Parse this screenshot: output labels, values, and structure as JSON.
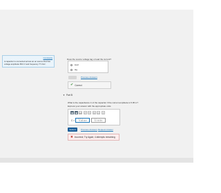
{
  "stray_text": "",
  "left_panel": {
    "constants_link": "Constants",
    "problem_text": "A capacitor is connected across an ac source that has voltage amplitude 58.0 V and frequency 77.0 Hz."
  },
  "part_a": {
    "question": "Does the source voltage lag or lead the current?",
    "options": [
      "lead",
      "lag"
    ],
    "previous_answers_link": "Previous Answers",
    "feedback": "Correct"
  },
  "part_b": {
    "toggle_icon": "triangle-down-icon",
    "label": "Part B",
    "question": "What is the capacitance C of the capacitor if the current amplitude is 5.05 A ?",
    "instruction": "Express your answer with the appropriate units.",
    "toolbar": [
      "▦",
      "▣",
      "μA",
      "↶",
      "↷",
      "↻",
      "▭",
      "?"
    ],
    "answer_label": "C =",
    "value_placeholder": "Value",
    "units_placeholder": "Units",
    "submit_label": "Submit",
    "previous_answers_link": "Previous Answers",
    "request_answer_link": "Request Answer",
    "feedback": "Incorrect; Try Again; 4 attempts remaining"
  },
  "colors": {
    "link": "#1a73b5",
    "submit": "#1a5e99",
    "correct": "#3a8f3a",
    "incorrect": "#c0392b"
  }
}
